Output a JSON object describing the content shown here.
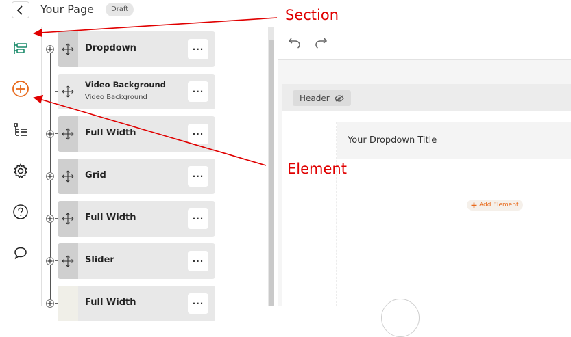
{
  "header": {
    "page_title": "Your Page",
    "status_badge": "Draft",
    "back_icon": "chevron-left-icon"
  },
  "rail": {
    "items": [
      {
        "icon": "section-layers-icon",
        "color": "#1a8a6a"
      },
      {
        "icon": "add-element-icon",
        "color": "#e86a1c"
      },
      {
        "icon": "tree-structure-icon"
      },
      {
        "icon": "gear-icon"
      },
      {
        "icon": "help-icon"
      },
      {
        "icon": "comment-icon"
      }
    ]
  },
  "tree": {
    "rows": [
      {
        "label": "Dropdown",
        "sublabel": ""
      },
      {
        "label": "Video Background",
        "sublabel": "Video Background"
      },
      {
        "label": "Full Width",
        "sublabel": ""
      },
      {
        "label": "Grid",
        "sublabel": ""
      },
      {
        "label": "Full Width",
        "sublabel": ""
      },
      {
        "label": "Slider",
        "sublabel": ""
      },
      {
        "label": "Full Width",
        "sublabel": ""
      }
    ],
    "more_label": "···"
  },
  "canvas": {
    "header_chip": "Header",
    "dropdown_title": "Your Dropdown Title",
    "add_element": "Add Element",
    "accent_color": "#e86a1c"
  },
  "annotations": {
    "section": "Section",
    "element": "Element",
    "color": "#e00000"
  }
}
